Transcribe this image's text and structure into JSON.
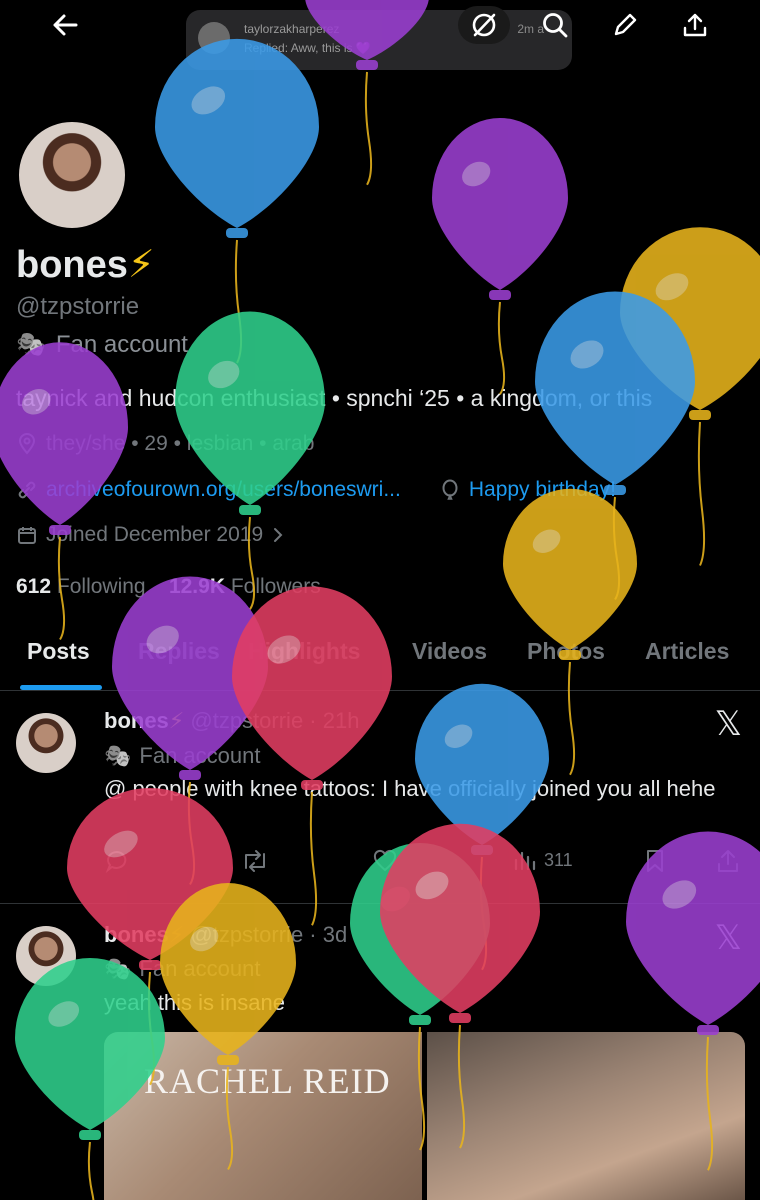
{
  "topbar": {
    "back_icon": "arrow-left-icon",
    "notification": {
      "name": "taylorzakharperez",
      "text": "Replied: Aww, this is 💜",
      "time": "2m a"
    },
    "actions": [
      "grok-icon",
      "search-icon",
      "edit-icon",
      "share-icon"
    ]
  },
  "profile": {
    "display_name": "bones",
    "name_emoji": "⚡",
    "handle": "@tzpstorrie",
    "label_icon": "🎭",
    "label": "Fan account",
    "bio": "taynick and hudcon enthusiast • spnchi ‘25 • a kingdom, or this",
    "location": "they/she • 29 • lesbian • arab",
    "link": "archiveofourown.org/users/boneswri...",
    "birthday": "Happy birthday!",
    "joined": "Joined December 2019",
    "following_count": "612",
    "following_label": "Following",
    "followers_count": "12.9K",
    "followers_label": "Followers"
  },
  "tabs": [
    "Posts",
    "Replies",
    "Highlights",
    "Videos",
    "Photos",
    "Articles"
  ],
  "posts": [
    {
      "name": "bones",
      "emoji": "⚡",
      "meta": "@tzpstorrie · 21h",
      "label": "Fan account",
      "text": "@ people with knee tattoos: I have officially joined you all hehe",
      "views": "311"
    },
    {
      "name": "bones",
      "emoji": "⚡",
      "meta": "@tzpstorrie · 3d",
      "label": "Fan account",
      "text": "yeah this is insane",
      "media_title": "RACHEL REID"
    }
  ],
  "colors": {
    "accent": "#1d9bf0",
    "balloon_blue": "#3b9be8",
    "balloon_purple": "#9b3fd1",
    "balloon_yellow": "#e8b41c",
    "balloon_green": "#2fd08c",
    "balloon_red": "#e23e62"
  }
}
